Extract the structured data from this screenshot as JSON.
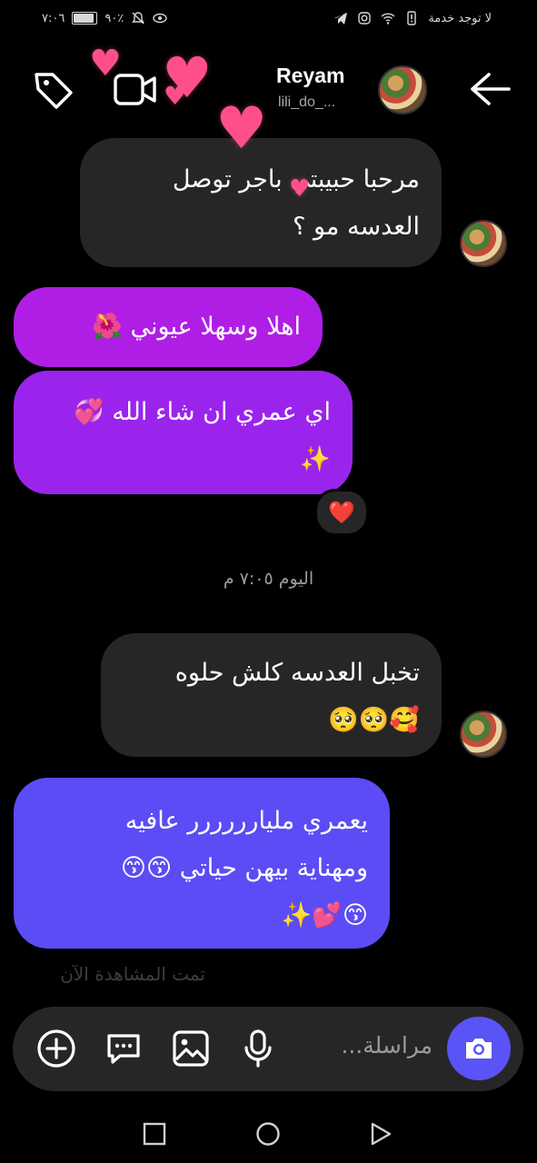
{
  "status_bar": {
    "time": "٧:٠٦",
    "battery_pct": "٩٠٪",
    "battery_level": 0.9,
    "carrier_text": "لا توجد خدمة"
  },
  "header": {
    "name": "Reyam",
    "username": "lili_do_...",
    "icons": [
      "tag-icon",
      "video-call-icon",
      "back-arrow-icon"
    ]
  },
  "messages": [
    {
      "side": "in",
      "lines": [
        "مرحبا حبيبتي باجر توصل",
        "العدسه مو ؟"
      ]
    },
    {
      "side": "out",
      "lines": [
        "اهلا وسهلا عيوني 🌺"
      ]
    },
    {
      "side": "out",
      "lines": [
        "اي عمري ان شاء الله 💞",
        "✨"
      ],
      "reaction": "❤️"
    },
    {
      "side": "in",
      "lines": [
        "تخبل العدسه كلش حلوه",
        "🥰🥺🥺"
      ]
    },
    {
      "side": "out",
      "lines": [
        "يعمري مليارررررر عافيه",
        "ومهناية بيهن حياتي 😙😙",
        "😙💕✨"
      ]
    }
  ],
  "time_separator": "اليوم ٧:٠٥ م",
  "seen_label": "تمت المشاهدة الآن",
  "composer": {
    "placeholder": "مراسلة...",
    "icons": [
      "camera-icon",
      "microphone-icon",
      "gallery-icon",
      "sticker-icon",
      "add-icon"
    ]
  },
  "colors": {
    "background": "#000000",
    "incoming_bubble": "#262626",
    "outgoing_1": "#b01ee6",
    "outgoing_2": "#9b24ec",
    "outgoing_3": "#5b4cf5",
    "camera_button": "#5a53f5",
    "hearts": "#ff4f8b"
  }
}
